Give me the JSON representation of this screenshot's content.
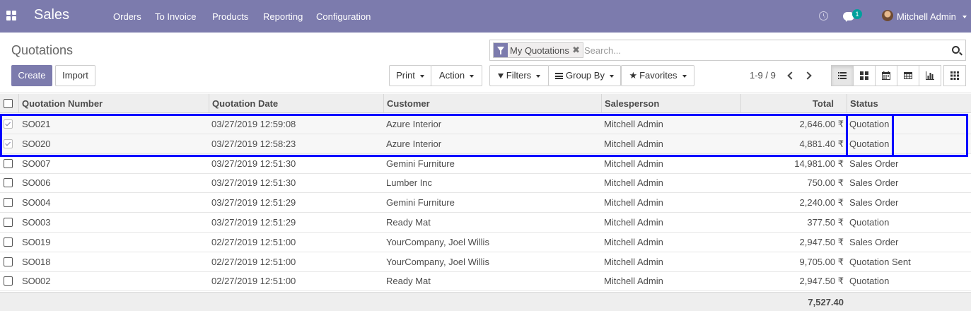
{
  "app": {
    "name": "Sales",
    "menu": [
      "Orders",
      "To Invoice",
      "Products",
      "Reporting",
      "Configuration"
    ],
    "chat_count": "1",
    "user": "Mitchell Admin"
  },
  "control_panel": {
    "title": "Quotations",
    "create_label": "Create",
    "import_label": "Import",
    "print_label": "Print",
    "action_label": "Action",
    "filters_label": "Filters",
    "groupby_label": "Group By",
    "favorites_label": "Favorites",
    "facet_label": "My Quotations",
    "search_placeholder": "Search...",
    "pager": "1-9 / 9",
    "active_view": "list"
  },
  "table": {
    "headers": [
      "Quotation Number",
      "Quotation Date",
      "Customer",
      "Salesperson",
      "Total",
      "Status"
    ],
    "rows": [
      {
        "number": "SO021",
        "date": "03/27/2019 12:59:08",
        "customer": "Azure Interior",
        "salesperson": "Mitchell Admin",
        "total": "2,646.00 ₹",
        "status": "Quotation",
        "selected": true
      },
      {
        "number": "SO020",
        "date": "03/27/2019 12:58:23",
        "customer": "Azure Interior",
        "salesperson": "Mitchell Admin",
        "total": "4,881.40 ₹",
        "status": "Quotation",
        "selected": true
      },
      {
        "number": "SO007",
        "date": "03/27/2019 12:51:30",
        "customer": "Gemini Furniture",
        "salesperson": "Mitchell Admin",
        "total": "14,981.00 ₹",
        "status": "Sales Order",
        "selected": false
      },
      {
        "number": "SO006",
        "date": "03/27/2019 12:51:30",
        "customer": "Lumber Inc",
        "salesperson": "Mitchell Admin",
        "total": "750.00 ₹",
        "status": "Sales Order",
        "selected": false
      },
      {
        "number": "SO004",
        "date": "03/27/2019 12:51:29",
        "customer": "Gemini Furniture",
        "salesperson": "Mitchell Admin",
        "total": "2,240.00 ₹",
        "status": "Sales Order",
        "selected": false
      },
      {
        "number": "SO003",
        "date": "03/27/2019 12:51:29",
        "customer": "Ready Mat",
        "salesperson": "Mitchell Admin",
        "total": "377.50 ₹",
        "status": "Quotation",
        "selected": false
      },
      {
        "number": "SO019",
        "date": "02/27/2019 12:51:00",
        "customer": "YourCompany, Joel Willis",
        "salesperson": "Mitchell Admin",
        "total": "2,947.50 ₹",
        "status": "Sales Order",
        "selected": false
      },
      {
        "number": "SO018",
        "date": "02/27/2019 12:51:00",
        "customer": "YourCompany, Joel Willis",
        "salesperson": "Mitchell Admin",
        "total": "9,705.00 ₹",
        "status": "Quotation Sent",
        "selected": false
      },
      {
        "number": "SO002",
        "date": "02/27/2019 12:51:00",
        "customer": "Ready Mat",
        "salesperson": "Mitchell Admin",
        "total": "2,947.50 ₹",
        "status": "Quotation",
        "selected": false
      }
    ],
    "footer_total": "7,527.40"
  },
  "colors": {
    "brand": "#7c7bad",
    "badge": "#00a09d",
    "highlight": "#0000ff"
  }
}
